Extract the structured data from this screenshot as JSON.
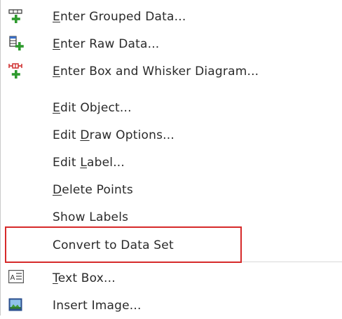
{
  "menu": {
    "items": [
      {
        "pre": "",
        "u": "E",
        "post": "nter Grouped Data...",
        "icon": "grouped-data-plus-icon"
      },
      {
        "pre": "",
        "u": "E",
        "post": "nter Raw Data...",
        "icon": "raw-data-plus-icon"
      },
      {
        "pre": "",
        "u": "E",
        "post": "nter Box and Whisker Diagram...",
        "icon": "box-whisker-plus-icon"
      },
      {
        "pre": "",
        "u": "E",
        "post": "dit Object..."
      },
      {
        "pre": "Edit ",
        "u": "D",
        "post": "raw Options..."
      },
      {
        "pre": "Edit ",
        "u": "L",
        "post": "abel..."
      },
      {
        "pre": "",
        "u": "D",
        "post": "elete Points"
      },
      {
        "pre": "",
        "u": "",
        "post": "Show Labels"
      },
      {
        "pre": "",
        "u": "",
        "post": "Convert to Data Set"
      },
      {
        "pre": "",
        "u": "T",
        "post": "ext Box...",
        "icon": "text-box-icon"
      },
      {
        "pre": "",
        "u": "",
        "post": "Insert Image...",
        "icon": "image-icon"
      }
    ]
  },
  "colors": {
    "highlight_border": "#d62a2a",
    "icon_plus": "#2e9a2e",
    "icon_blue": "#3a6fc7",
    "icon_red": "#cc2222"
  }
}
